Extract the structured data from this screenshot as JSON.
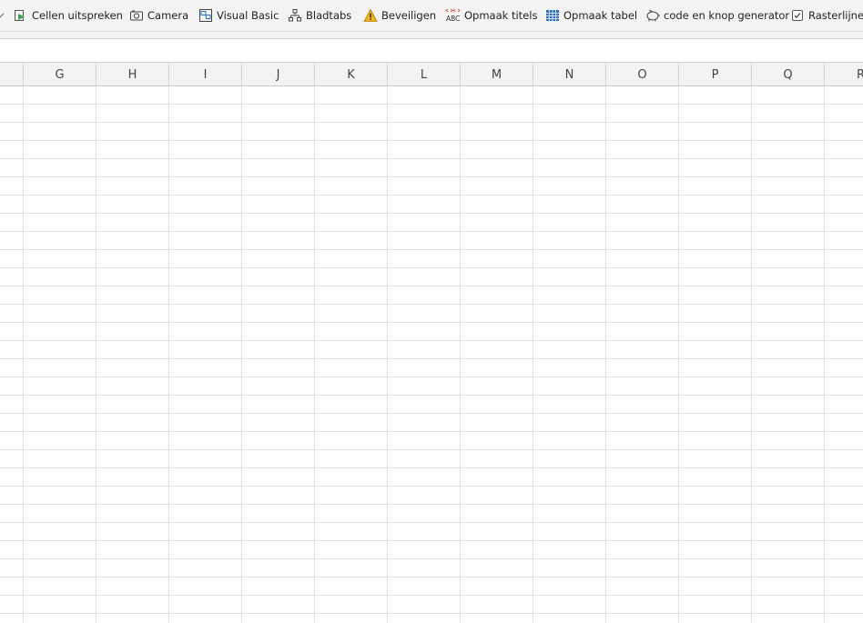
{
  "toolbar": {
    "items": [
      {
        "label": "Cellen uitspreken",
        "icon": "speak-cells-icon"
      },
      {
        "label": "Camera",
        "icon": "camera-icon"
      },
      {
        "label": "Visual Basic",
        "icon": "visual-basic-icon"
      },
      {
        "label": "Bladtabs",
        "icon": "sheet-tabs-icon"
      },
      {
        "label": "Beveiligen",
        "icon": "warning-icon"
      },
      {
        "label": "Opmaak titels",
        "icon": "abc-icon"
      },
      {
        "label": "Opmaak tabel",
        "icon": "table-icon"
      },
      {
        "label": "code en knop generator",
        "icon": "piggy-bank-icon"
      },
      {
        "label": "Rasterlijnen",
        "icon": "checkbox-icon"
      }
    ]
  },
  "sheet": {
    "columns": [
      "G",
      "H",
      "I",
      "J",
      "K",
      "L",
      "M",
      "N",
      "O",
      "P",
      "Q",
      "R"
    ]
  }
}
